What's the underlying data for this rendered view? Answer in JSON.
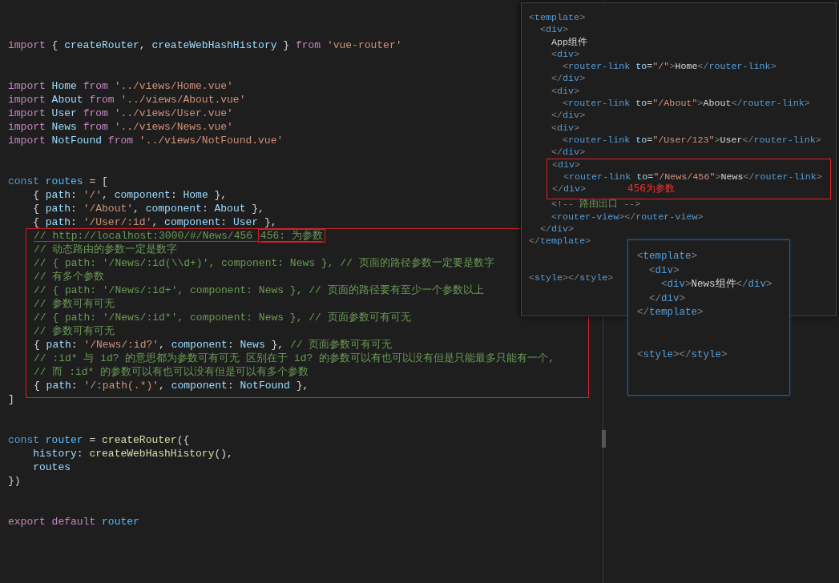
{
  "editor": {
    "blocks": [
      [
        {
          "tokens": [
            {
              "kind": "keyword",
              "text": "import "
            },
            {
              "kind": "punctuation",
              "text": "{ "
            },
            {
              "kind": "variable",
              "text": "createRouter"
            },
            {
              "kind": "punctuation",
              "text": ", "
            },
            {
              "kind": "variable",
              "text": "createWebHashHistory "
            },
            {
              "kind": "punctuation",
              "text": "} "
            },
            {
              "kind": "keyword",
              "text": "from "
            },
            {
              "kind": "string",
              "text": "'vue-router'"
            }
          ]
        }
      ],
      [
        {
          "tokens": [
            {
              "kind": "keyword",
              "text": "import "
            },
            {
              "kind": "variable",
              "text": "Home "
            },
            {
              "kind": "keyword",
              "text": "from "
            },
            {
              "kind": "string",
              "text": "'../views/Home.vue'"
            }
          ]
        },
        {
          "tokens": [
            {
              "kind": "keyword",
              "text": "import "
            },
            {
              "kind": "variable",
              "text": "About "
            },
            {
              "kind": "keyword",
              "text": "from "
            },
            {
              "kind": "string",
              "text": "'../views/About.vue'"
            }
          ]
        },
        {
          "tokens": [
            {
              "kind": "keyword",
              "text": "import "
            },
            {
              "kind": "variable",
              "text": "User "
            },
            {
              "kind": "keyword",
              "text": "from "
            },
            {
              "kind": "string",
              "text": "'../views/User.vue'"
            }
          ]
        },
        {
          "tokens": [
            {
              "kind": "keyword",
              "text": "import "
            },
            {
              "kind": "variable",
              "text": "News "
            },
            {
              "kind": "keyword",
              "text": "from "
            },
            {
              "kind": "string",
              "text": "'../views/News.vue'"
            }
          ]
        },
        {
          "tokens": [
            {
              "kind": "keyword",
              "text": "import "
            },
            {
              "kind": "variable",
              "text": "NotFound "
            },
            {
              "kind": "keyword",
              "text": "from "
            },
            {
              "kind": "string",
              "text": "'../views/NotFound.vue'"
            }
          ]
        }
      ],
      [
        {
          "tokens": [
            {
              "kind": "storage",
              "text": "const "
            },
            {
              "kind": "constant",
              "text": "routes "
            },
            {
              "kind": "punctuation",
              "text": "= ["
            }
          ]
        },
        {
          "tokens": [
            {
              "kind": "punctuation",
              "text": "    { "
            },
            {
              "kind": "variable",
              "text": "path"
            },
            {
              "kind": "punctuation",
              "text": ": "
            },
            {
              "kind": "string",
              "text": "'/'"
            },
            {
              "kind": "punctuation",
              "text": ", "
            },
            {
              "kind": "variable",
              "text": "component"
            },
            {
              "kind": "punctuation",
              "text": ": "
            },
            {
              "kind": "variable",
              "text": "Home "
            },
            {
              "kind": "punctuation",
              "text": "},"
            }
          ]
        },
        {
          "tokens": [
            {
              "kind": "punctuation",
              "text": "    { "
            },
            {
              "kind": "variable",
              "text": "path"
            },
            {
              "kind": "punctuation",
              "text": ": "
            },
            {
              "kind": "string",
              "text": "'/About'"
            },
            {
              "kind": "punctuation",
              "text": ", "
            },
            {
              "kind": "variable",
              "text": "component"
            },
            {
              "kind": "punctuation",
              "text": ": "
            },
            {
              "kind": "variable",
              "text": "About "
            },
            {
              "kind": "punctuation",
              "text": "},"
            }
          ]
        },
        {
          "tokens": [
            {
              "kind": "punctuation",
              "text": "    { "
            },
            {
              "kind": "variable",
              "text": "path"
            },
            {
              "kind": "punctuation",
              "text": ": "
            },
            {
              "kind": "string",
              "text": "'/User/:id'"
            },
            {
              "kind": "punctuation",
              "text": ", "
            },
            {
              "kind": "variable",
              "text": "component"
            },
            {
              "kind": "punctuation",
              "text": ": "
            },
            {
              "kind": "variable",
              "text": "User "
            },
            {
              "kind": "punctuation",
              "text": "},"
            }
          ]
        },
        {
          "kind": "boxed",
          "lines": [
            {
              "underlined": true,
              "tokens": [
                {
                  "kind": "comment",
                  "text": "// http://localhost:3000/#/News/456 "
                },
                {
                  "kind": "comment",
                  "text": "456: 为参数",
                  "boxed": true
                }
              ]
            },
            {
              "tokens": [
                {
                  "kind": "comment",
                  "text": "// 动态路由的参数一定是数字"
                }
              ]
            },
            {
              "tokens": [
                {
                  "kind": "comment",
                  "text": "// { path: '/News/:id(\\\\d+)', component: News }, // 页面的路径参数一定要是数字"
                }
              ]
            },
            {
              "tokens": [
                {
                  "kind": "comment",
                  "text": "// 有多个参数"
                }
              ]
            },
            {
              "tokens": [
                {
                  "kind": "comment",
                  "text": "// { path: '/News/:id+', component: News }, // 页面的路径要有至少一个参数以上"
                }
              ]
            },
            {
              "tokens": [
                {
                  "kind": "comment",
                  "text": "// 参数可有可无"
                }
              ]
            },
            {
              "tokens": [
                {
                  "kind": "comment",
                  "text": "// { path: '/News/:id*', component: News }, // 页面参数可有可无"
                }
              ]
            },
            {
              "tokens": [
                {
                  "kind": "comment",
                  "text": "// 参数可有可无"
                }
              ]
            },
            {
              "tokens": [
                {
                  "kind": "punctuation",
                  "text": "{ "
                },
                {
                  "kind": "variable",
                  "text": "path"
                },
                {
                  "kind": "punctuation",
                  "text": ": "
                },
                {
                  "kind": "string",
                  "text": "'/News/:id?'"
                },
                {
                  "kind": "punctuation",
                  "text": ", "
                },
                {
                  "kind": "variable",
                  "text": "component"
                },
                {
                  "kind": "punctuation",
                  "text": ": "
                },
                {
                  "kind": "variable",
                  "text": "News "
                },
                {
                  "kind": "punctuation",
                  "text": "}, "
                },
                {
                  "kind": "comment",
                  "text": "// 页面参数可有可无"
                }
              ]
            },
            {
              "tokens": [
                {
                  "kind": "comment",
                  "text": "// :id* 与 id? 的意思都为参数可有可无 区别在于 id? 的参数可以有也可以没有但是只能最多只能有一个,"
                }
              ]
            },
            {
              "tokens": [
                {
                  "kind": "comment",
                  "text": "// 而 :id* 的参数可以有也可以没有但是可以有多个参数"
                }
              ]
            },
            {
              "tokens": [
                {
                  "kind": "punctuation",
                  "text": "{ "
                },
                {
                  "kind": "variable",
                  "text": "path"
                },
                {
                  "kind": "punctuation",
                  "text": ": "
                },
                {
                  "kind": "string",
                  "text": "'/:path(.*)'"
                },
                {
                  "kind": "punctuation",
                  "text": ", "
                },
                {
                  "kind": "variable",
                  "text": "component"
                },
                {
                  "kind": "punctuation",
                  "text": ": "
                },
                {
                  "kind": "variable",
                  "text": "NotFound "
                },
                {
                  "kind": "punctuation",
                  "text": "},"
                }
              ]
            }
          ]
        },
        {
          "tokens": [
            {
              "kind": "punctuation",
              "text": "]"
            }
          ]
        }
      ],
      [
        {
          "tokens": [
            {
              "kind": "storage",
              "text": "const "
            },
            {
              "kind": "constant",
              "text": "router "
            },
            {
              "kind": "punctuation",
              "text": "= "
            },
            {
              "kind": "function",
              "text": "createRouter"
            },
            {
              "kind": "punctuation",
              "text": "({"
            }
          ]
        },
        {
          "tokens": [
            {
              "kind": "variable",
              "text": "    history"
            },
            {
              "kind": "punctuation",
              "text": ": "
            },
            {
              "kind": "function",
              "text": "createWebHashHistory"
            },
            {
              "kind": "punctuation",
              "text": "(),"
            }
          ]
        },
        {
          "tokens": [
            {
              "kind": "variable",
              "text": "    routes"
            }
          ]
        },
        {
          "tokens": [
            {
              "kind": "punctuation",
              "text": "})"
            }
          ]
        }
      ],
      [
        {
          "tokens": [
            {
              "kind": "keyword",
              "text": "export default "
            },
            {
              "kind": "constant",
              "text": "router"
            }
          ]
        }
      ]
    ]
  },
  "app_panel": {
    "blocks": [
      [
        {
          "tokens": [
            {
              "kind": "bracket",
              "text": "<"
            },
            {
              "kind": "tag",
              "text": "template"
            },
            {
              "kind": "bracket",
              "text": ">"
            }
          ]
        },
        {
          "tokens": [
            {
              "kind": "bracket",
              "text": "  <"
            },
            {
              "kind": "tag",
              "text": "div"
            },
            {
              "kind": "bracket",
              "text": ">"
            }
          ]
        },
        {
          "tokens": [
            {
              "kind": "text",
              "text": "    App组件"
            }
          ]
        },
        {
          "tokens": [
            {
              "kind": "bracket",
              "text": "    <"
            },
            {
              "kind": "tag",
              "text": "div"
            },
            {
              "kind": "bracket",
              "text": ">"
            }
          ]
        },
        {
          "tokens": [
            {
              "kind": "bracket",
              "text": "      <"
            },
            {
              "kind": "tag",
              "text": "router-link "
            },
            {
              "kind": "attribute",
              "text": "to"
            },
            {
              "kind": "punctuation",
              "text": "="
            },
            {
              "kind": "string",
              "text": "\"/\""
            },
            {
              "kind": "bracket",
              "text": ">"
            },
            {
              "kind": "text",
              "text": "Home"
            },
            {
              "kind": "bracket",
              "text": "</"
            },
            {
              "kind": "tag",
              "text": "router-link"
            },
            {
              "kind": "bracket",
              "text": ">"
            }
          ]
        },
        {
          "tokens": [
            {
              "kind": "bracket",
              "text": "    </"
            },
            {
              "kind": "tag",
              "text": "div"
            },
            {
              "kind": "bracket",
              "text": ">"
            }
          ]
        },
        {
          "tokens": [
            {
              "kind": "bracket",
              "text": "    <"
            },
            {
              "kind": "tag",
              "text": "div"
            },
            {
              "kind": "bracket",
              "text": ">"
            }
          ]
        },
        {
          "tokens": [
            {
              "kind": "bracket",
              "text": "      <"
            },
            {
              "kind": "tag",
              "text": "router-link "
            },
            {
              "kind": "attribute",
              "text": "to"
            },
            {
              "kind": "punctuation",
              "text": "="
            },
            {
              "kind": "string",
              "text": "\"/About\""
            },
            {
              "kind": "bracket",
              "text": ">"
            },
            {
              "kind": "text",
              "text": "About"
            },
            {
              "kind": "bracket",
              "text": "</"
            },
            {
              "kind": "tag",
              "text": "router-link"
            },
            {
              "kind": "bracket",
              "text": ">"
            }
          ]
        },
        {
          "tokens": [
            {
              "kind": "bracket",
              "text": "    </"
            },
            {
              "kind": "tag",
              "text": "div"
            },
            {
              "kind": "bracket",
              "text": ">"
            }
          ]
        },
        {
          "tokens": [
            {
              "kind": "bracket",
              "text": "    <"
            },
            {
              "kind": "tag",
              "text": "div"
            },
            {
              "kind": "bracket",
              "text": ">"
            }
          ]
        },
        {
          "tokens": [
            {
              "kind": "bracket",
              "text": "      <"
            },
            {
              "kind": "tag",
              "text": "router-link "
            },
            {
              "kind": "attribute",
              "text": "to"
            },
            {
              "kind": "punctuation",
              "text": "="
            },
            {
              "kind": "string",
              "text": "\"/User/123\""
            },
            {
              "kind": "bracket",
              "text": ">"
            },
            {
              "kind": "text",
              "text": "User"
            },
            {
              "kind": "bracket",
              "text": "</"
            },
            {
              "kind": "tag",
              "text": "router-link"
            },
            {
              "kind": "bracket",
              "text": ">"
            }
          ]
        },
        {
          "tokens": [
            {
              "kind": "bracket",
              "text": "    </"
            },
            {
              "kind": "tag",
              "text": "div"
            },
            {
              "kind": "bracket",
              "text": ">"
            }
          ]
        },
        {
          "kind": "boxed",
          "note": "456为参数",
          "lines": [
            {
              "tokens": [
                {
                  "kind": "bracket",
                  "text": "<"
                },
                {
                  "kind": "tag",
                  "text": "div"
                },
                {
                  "kind": "bracket",
                  "text": ">"
                }
              ]
            },
            {
              "tokens": [
                {
                  "kind": "bracket",
                  "text": "  <"
                },
                {
                  "kind": "tag",
                  "text": "router-link "
                },
                {
                  "kind": "attribute",
                  "text": "to"
                },
                {
                  "kind": "punctuation",
                  "text": "="
                },
                {
                  "kind": "string",
                  "text": "\"/News/456\""
                },
                {
                  "kind": "bracket",
                  "text": ">"
                },
                {
                  "kind": "text",
                  "text": "News"
                },
                {
                  "kind": "bracket",
                  "text": "</"
                },
                {
                  "kind": "tag",
                  "text": "router-link"
                },
                {
                  "kind": "bracket",
                  "text": ">"
                }
              ]
            },
            {
              "tokens": [
                {
                  "kind": "bracket",
                  "text": "</"
                },
                {
                  "kind": "tag",
                  "text": "div"
                },
                {
                  "kind": "bracket",
                  "text": ">"
                }
              ]
            }
          ]
        },
        {
          "tokens": [
            {
              "kind": "bracket",
              "text": "    <!--"
            },
            {
              "kind": "comment",
              "text": " 路由出口 "
            },
            {
              "kind": "bracket",
              "text": "-->"
            }
          ]
        },
        {
          "tokens": [
            {
              "kind": "bracket",
              "text": "    <"
            },
            {
              "kind": "tag",
              "text": "router-view"
            },
            {
              "kind": "bracket",
              "text": "></"
            },
            {
              "kind": "tag",
              "text": "router-view"
            },
            {
              "kind": "bracket",
              "text": ">"
            }
          ]
        },
        {
          "tokens": [
            {
              "kind": "bracket",
              "text": "  </"
            },
            {
              "kind": "tag",
              "text": "div"
            },
            {
              "kind": "bracket",
              "text": ">"
            }
          ]
        },
        {
          "tokens": [
            {
              "kind": "bracket",
              "text": "</"
            },
            {
              "kind": "tag",
              "text": "template"
            },
            {
              "kind": "bracket",
              "text": ">"
            }
          ]
        }
      ],
      [
        {
          "tokens": [
            {
              "kind": "bracket",
              "text": "<"
            },
            {
              "kind": "tag",
              "text": "style"
            },
            {
              "kind": "bracket",
              "text": "></"
            },
            {
              "kind": "tag",
              "text": "style"
            },
            {
              "kind": "bracket",
              "text": ">"
            }
          ]
        }
      ]
    ]
  },
  "news_panel": {
    "blocks": [
      [
        {
          "tokens": [
            {
              "kind": "bracket",
              "text": "<"
            },
            {
              "kind": "tag",
              "text": "template"
            },
            {
              "kind": "bracket",
              "text": ">"
            }
          ]
        },
        {
          "tokens": [
            {
              "kind": "bracket",
              "text": "  <"
            },
            {
              "kind": "tag",
              "text": "div"
            },
            {
              "kind": "bracket",
              "text": ">"
            }
          ]
        },
        {
          "tokens": [
            {
              "kind": "bracket",
              "text": "    <"
            },
            {
              "kind": "tag",
              "text": "div"
            },
            {
              "kind": "bracket",
              "text": ">"
            },
            {
              "kind": "text",
              "text": "News组件"
            },
            {
              "kind": "bracket",
              "text": "</"
            },
            {
              "kind": "tag",
              "text": "div"
            },
            {
              "kind": "bracket",
              "text": ">"
            }
          ]
        },
        {
          "tokens": [
            {
              "kind": "bracket",
              "text": "  </"
            },
            {
              "kind": "tag",
              "text": "div"
            },
            {
              "kind": "bracket",
              "text": ">"
            }
          ]
        },
        {
          "tokens": [
            {
              "kind": "bracket",
              "text": "</"
            },
            {
              "kind": "tag",
              "text": "template"
            },
            {
              "kind": "bracket",
              "text": ">"
            }
          ]
        }
      ],
      [
        {
          "tokens": [
            {
              "kind": "bracket",
              "text": "<"
            },
            {
              "kind": "tag",
              "text": "style"
            },
            {
              "kind": "bracket",
              "text": "></"
            },
            {
              "kind": "tag",
              "text": "style"
            },
            {
              "kind": "bracket",
              "text": ">"
            }
          ]
        }
      ]
    ]
  }
}
